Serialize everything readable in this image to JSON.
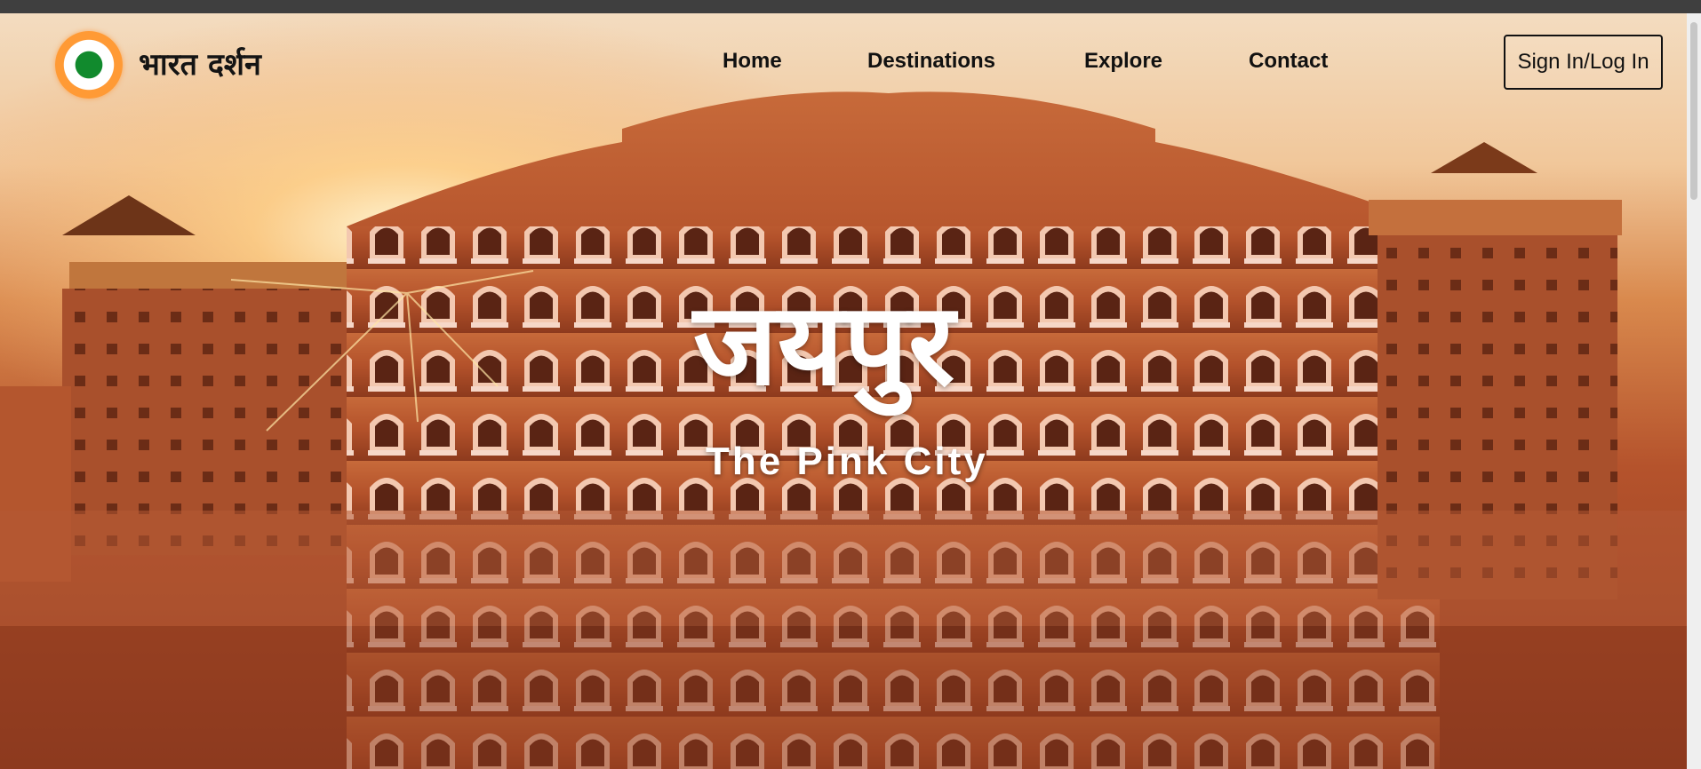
{
  "header": {
    "site_title": "भारत दर्शन",
    "nav": [
      "Home",
      "Destinations",
      "Explore",
      "Contact"
    ],
    "signin_label": "Sign In/Log In"
  },
  "hero": {
    "title": "जयपुर",
    "subtitle": "The Pink City",
    "background": "hawa-mahal-photo"
  },
  "colors": {
    "brand_saffron": "#ff9a35",
    "brand_green": "#118a2d",
    "facade": "#b5532c",
    "sky": "#f3dcc0"
  },
  "icons": {
    "logo": "tricolor-chakra-icon"
  }
}
